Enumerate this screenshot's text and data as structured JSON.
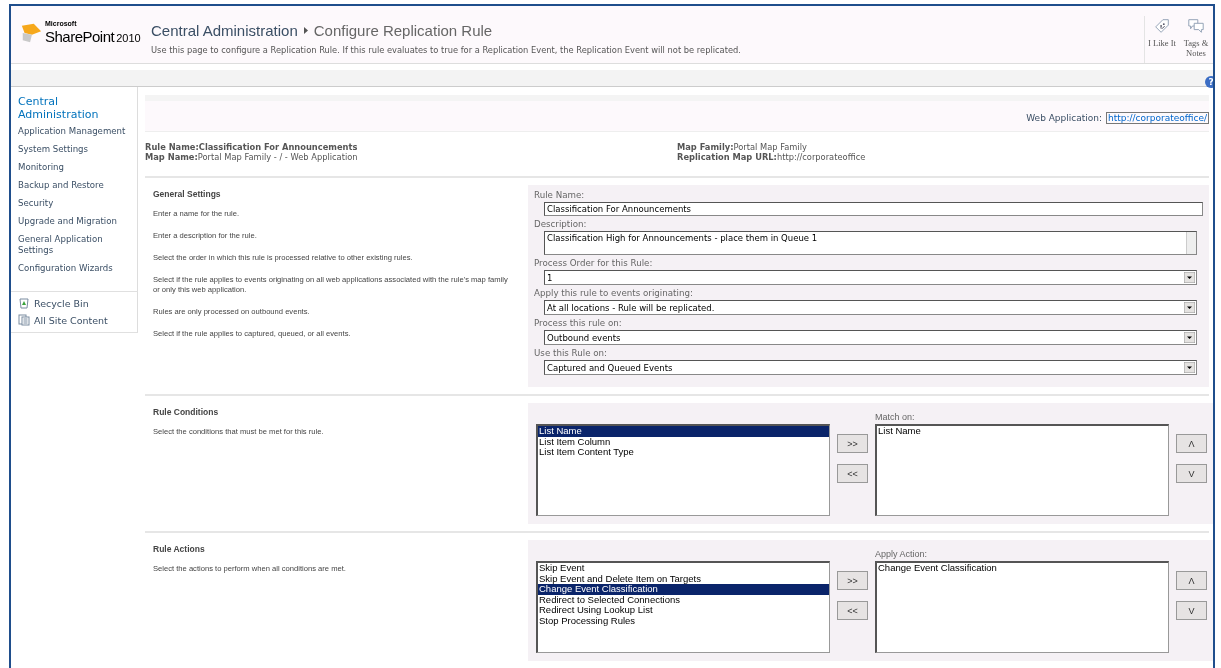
{
  "brand": {
    "maker": "Microsoft",
    "product": "SharePoint",
    "version": "2010"
  },
  "header": {
    "breadcrumb": [
      "Central Administration",
      "Configure Replication Rule"
    ],
    "description": "Use this page to configure a Replication Rule. If this rule evaluates to true for a Replication Event, the Replication Event will not be replicated."
  },
  "social": [
    {
      "label": "I Like It",
      "kind": "like"
    },
    {
      "label": "Tags & Notes",
      "kind": "tags"
    }
  ],
  "help": "?",
  "sidebar": {
    "heading": "Central Administration",
    "items": [
      "Application Management",
      "System Settings",
      "Monitoring",
      "Backup and Restore",
      "Security",
      "Upgrade and Migration",
      "General Application Settings",
      "Configuration Wizards"
    ],
    "links": [
      {
        "label": "Recycle Bin",
        "kind": "recycle"
      },
      {
        "label": "All Site Content",
        "kind": "content"
      }
    ]
  },
  "web_application": {
    "label": "Web Application:",
    "url": "http://corporateoffice/"
  },
  "rule_info": [
    [
      {
        "label": "Rule Name:",
        "value": "Classification For Announcements",
        "bold_value": true
      },
      {
        "label": "Map Name:",
        "value": "Portal Map Family - / - Web Application",
        "bold_value": false
      }
    ],
    [
      {
        "label": "Map Family:",
        "value": "Portal Map Family",
        "bold_value": false
      },
      {
        "label": "Replication Map URL:",
        "value": "http://corporateoffice",
        "bold_value": false
      }
    ]
  ],
  "general": {
    "title": "General Settings",
    "descriptions": [
      "Enter a name for the rule.",
      "Enter a description for the rule.",
      "Select the order in which this rule is processed relative to other existing rules.",
      "Select if the rule applies to events originating on all web applications associated with the rule's map family or only this web application.",
      "Rules are only processed on outbound events.",
      "Select if the rule applies to captured, queued, or all events."
    ],
    "fields": [
      {
        "label": "Rule Name:",
        "kind": "text",
        "value": "Classification For Announcements"
      },
      {
        "label": "Description:",
        "kind": "textarea",
        "value": "Classification High for Announcements - place them in Queue 1"
      },
      {
        "label": "Process Order for this Rule:",
        "kind": "select",
        "value": "1"
      },
      {
        "label": "Apply this rule to events originating:",
        "kind": "select",
        "value": "At all locations - Rule will be replicated."
      },
      {
        "label": "Process this rule on:",
        "kind": "select",
        "value": "Outbound events"
      },
      {
        "label": "Use this Rule on:",
        "kind": "select",
        "value": "Captured and Queued Events"
      }
    ]
  },
  "pickers": [
    {
      "title": "Rule Conditions",
      "description": "Select the conditions that must be met for this rule.",
      "available": [
        {
          "label": "List Name",
          "selected": true
        },
        {
          "label": "List Item Column",
          "selected": false
        },
        {
          "label": "List Item Content Type",
          "selected": false
        }
      ],
      "chosen_label": "Match on:",
      "chosen": [
        {
          "label": "List Name",
          "selected": false
        }
      ],
      "add": ">>",
      "remove": "<<",
      "up": "Λ",
      "down": "V"
    },
    {
      "title": "Rule Actions",
      "description": "Select the actions to perform when all conditions are met.",
      "available": [
        {
          "label": "Skip Event",
          "selected": false
        },
        {
          "label": "Skip Event and Delete Item on Targets",
          "selected": false
        },
        {
          "label": "Change Event Classification",
          "selected": true
        },
        {
          "label": "Redirect to Selected Connections",
          "selected": false
        },
        {
          "label": "Redirect Using Lookup List",
          "selected": false
        },
        {
          "label": "Stop Processing Rules",
          "selected": false
        }
      ],
      "chosen_label": "Apply Action:",
      "chosen": [
        {
          "label": "Change Event Classification",
          "selected": false
        }
      ],
      "add": ">>",
      "remove": "<<",
      "up": "Λ",
      "down": "V"
    }
  ]
}
